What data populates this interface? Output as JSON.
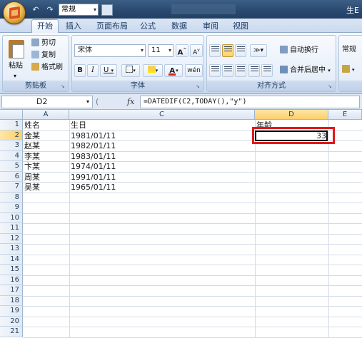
{
  "titlebar": {
    "format_value": "常规",
    "title_fragment": "生E"
  },
  "tabs": [
    {
      "label": "开始",
      "active": true
    },
    {
      "label": "插入",
      "active": false
    },
    {
      "label": "页面布局",
      "active": false
    },
    {
      "label": "公式",
      "active": false
    },
    {
      "label": "数据",
      "active": false
    },
    {
      "label": "审阅",
      "active": false
    },
    {
      "label": "视图",
      "active": false
    }
  ],
  "ribbon": {
    "clipboard": {
      "label": "剪贴板",
      "paste": "粘贴",
      "cut": "剪切",
      "copy": "复制",
      "format_painter": "格式刷"
    },
    "font": {
      "label": "字体",
      "font_name": "宋体",
      "font_size": "11",
      "bold": "B",
      "italic": "I",
      "underline": "U",
      "grow": "A",
      "shrink": "A",
      "phonetic": "wén"
    },
    "alignment": {
      "label": "对齐方式",
      "wrap_text": "自动换行",
      "merge_center": "合并后居中"
    },
    "number": {
      "format": "常规"
    }
  },
  "formula_bar": {
    "name_box": "D2",
    "fx": "fx",
    "formula": "=DATEDIF(C2,TODAY(),\"y\")"
  },
  "sheet": {
    "columns": [
      "A",
      "C",
      "D",
      "E"
    ],
    "selected_column": "D",
    "selected_row": "2",
    "rows": [
      "1",
      "2",
      "3",
      "4",
      "5",
      "6",
      "7",
      "8",
      "9",
      "10",
      "11",
      "12",
      "13",
      "14",
      "15",
      "16",
      "17",
      "18",
      "19",
      "20",
      "21"
    ],
    "header_row": {
      "a": "姓名",
      "c": "生日",
      "d": "年龄"
    },
    "data": [
      {
        "name": "金某",
        "birthday": "1981/01/11",
        "age": "33"
      },
      {
        "name": "赵某",
        "birthday": "1982/01/11",
        "age": ""
      },
      {
        "name": "李某",
        "birthday": "1983/01/11",
        "age": ""
      },
      {
        "name": "卞某",
        "birthday": "1974/01/11",
        "age": ""
      },
      {
        "name": "周某",
        "birthday": "1991/01/11",
        "age": ""
      },
      {
        "name": "吴某",
        "birthday": "1965/01/11",
        "age": ""
      }
    ]
  },
  "colors": {
    "highlight_box": "#e01a1a",
    "selected_header": "#fbcf6e"
  }
}
